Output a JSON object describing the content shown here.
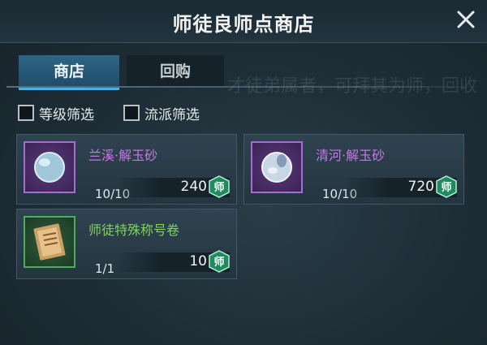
{
  "window": {
    "title": "师徒良师点商店"
  },
  "tabs": [
    {
      "label": "商店",
      "active": true
    },
    {
      "label": "回购",
      "active": false
    }
  ],
  "filters": [
    {
      "label": "等级筛选",
      "checked": false
    },
    {
      "label": "流派筛选",
      "checked": false
    }
  ],
  "items": [
    {
      "name": "兰溪·解玉砂",
      "stock": "10/10",
      "price": "240",
      "currency": "师",
      "rarity": "purple",
      "icon": "jade-sand-orb-icon"
    },
    {
      "name": "清河·解玉砂",
      "stock": "10/10",
      "price": "720",
      "currency": "师",
      "rarity": "purple",
      "icon": "jade-sand-orb-icon"
    },
    {
      "name": "师徒特殊称号卷",
      "stock": "1/1",
      "price": "10",
      "currency": "师",
      "rarity": "green",
      "icon": "scroll-book-icon"
    }
  ],
  "colors": {
    "accent": "#4ab0e0",
    "purple": "#c776e6",
    "green": "#7dd45c",
    "coin": "#1f8a5f"
  }
}
